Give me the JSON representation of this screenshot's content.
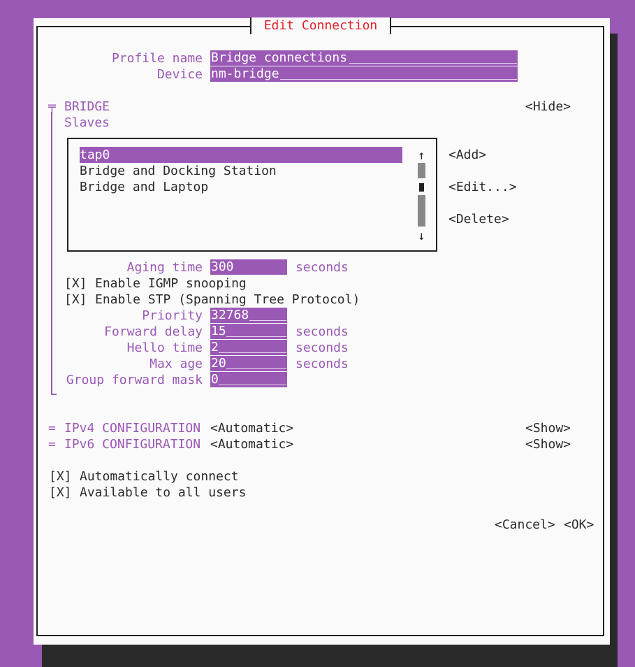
{
  "dialog": {
    "title": "Edit Connection"
  },
  "profile": {
    "name_label": "Profile name",
    "name_value": "Bridge connections"
  },
  "device": {
    "label": "Device",
    "value": "nm-bridge"
  },
  "bridge": {
    "section_marker": "╤",
    "section_label": "BRIDGE",
    "hide_button": "<Hide>",
    "slaves_label": "Slaves",
    "slaves": [
      "tap0",
      "Bridge and Docking Station",
      "Bridge and Laptop"
    ],
    "scroll_up": "↑",
    "scroll_down": "↓",
    "add_button": "<Add>",
    "edit_button": "<Edit...>",
    "delete_button": "<Delete>",
    "aging_time": {
      "label": "Aging time",
      "value": "300",
      "unit": "seconds"
    },
    "igmp": {
      "checkbox": "[X]",
      "label": "Enable IGMP snooping"
    },
    "stp": {
      "checkbox": "[X]",
      "label": "Enable STP (Spanning Tree Protocol)"
    },
    "priority": {
      "label": "Priority",
      "value": "32768"
    },
    "forward_delay": {
      "label": "Forward delay",
      "value": "15",
      "unit": "seconds"
    },
    "hello_time": {
      "label": "Hello time",
      "value": "2",
      "unit": "seconds"
    },
    "max_age": {
      "label": "Max age",
      "value": "20",
      "unit": "seconds"
    },
    "group_forward_mask": {
      "label": "Group forward mask",
      "value": "0"
    }
  },
  "ipv4": {
    "marker": "=",
    "label": "IPv4 CONFIGURATION",
    "mode": "<Automatic>",
    "show_button": "<Show>"
  },
  "ipv6": {
    "marker": "=",
    "label": "IPv6 CONFIGURATION",
    "mode": "<Automatic>",
    "show_button": "<Show>"
  },
  "auto_connect": {
    "checkbox": "[X]",
    "label": "Automatically connect"
  },
  "all_users": {
    "checkbox": "[X]",
    "label": "Available to all users"
  },
  "buttons": {
    "cancel": "<Cancel>",
    "ok": "<OK>"
  },
  "colors": {
    "accent": "#9b59b6",
    "title": "#e0222a",
    "background": "#fafafa",
    "shadow": "#2a2a2a"
  }
}
